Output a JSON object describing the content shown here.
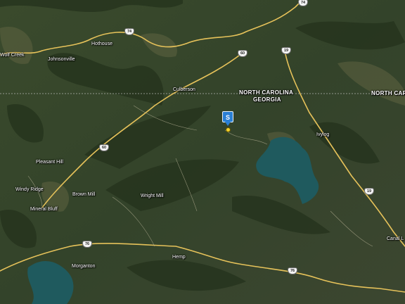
{
  "map": {
    "type": "satellite",
    "places": {
      "wolf_creek": "Wolf Creek",
      "johnsonville": "Johnsonville",
      "hothouse": "Hothouse",
      "culberson": "Culberson",
      "pleasant_hill": "Pleasant Hill",
      "windy_ridge": "Windy Ridge",
      "brown_mill": "Brown Mill",
      "mineral_bluff": "Mineral Bluff",
      "wright_mill": "Wright Mill",
      "morganton": "Morganton",
      "hemp": "Hemp",
      "ivylog": "Ivylog",
      "canal_lake": "Canal L"
    },
    "states": {
      "nc_center": "NORTH CAROLINA",
      "ga_center": "GEORGIA",
      "nc_right": "NORTH CARO"
    },
    "routes": {
      "us74_top": "74",
      "us74_mid": "74",
      "r60_north": "60",
      "r60_south": "60",
      "us19_north": "19",
      "us19_south": "19",
      "us76_west": "76",
      "us76_east": "76"
    },
    "marker": {
      "label": "S",
      "color": "#2a7fd4"
    },
    "colors": {
      "road": "#e6c25a",
      "water": "#1f5a5e",
      "border": "#cfcfcf"
    }
  }
}
